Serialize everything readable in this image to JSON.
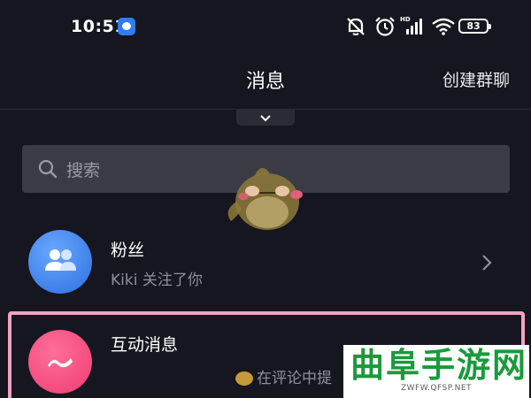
{
  "status_bar": {
    "time": "10:51",
    "network_label": "HD",
    "battery": "83",
    "icons": [
      "app-notification-icon",
      "mute-icon",
      "alarm-icon",
      "signal-icon",
      "wifi-icon",
      "battery-icon"
    ]
  },
  "header": {
    "title": "消息",
    "action_label": "创建群聊"
  },
  "search": {
    "placeholder": "搜索"
  },
  "list": {
    "items": [
      {
        "title": "粉丝",
        "subtitle": "Kiki 关注了你",
        "icon": "fans-icon",
        "color": "#3d86f0"
      },
      {
        "title": "互动消息",
        "subtitle": "在评论中提",
        "icon": "interaction-icon",
        "color": "#f4487e"
      }
    ]
  },
  "watermark": {
    "text": "曲阜手游网",
    "url": "ZWFW.QFSP.NET",
    "color": "#1a9a3c"
  },
  "colors": {
    "background": "#15161f",
    "search_bg": "#3a3b44",
    "highlight": "#f2a3c3"
  }
}
